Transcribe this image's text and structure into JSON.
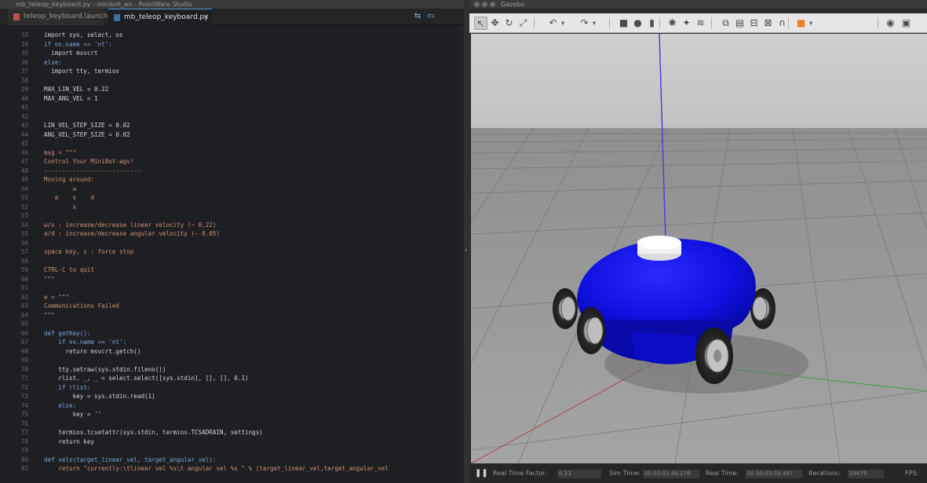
{
  "editor": {
    "window_title": "mb_teleop_keyboard.py - minibot_ws - RoboWare Studio",
    "tabs": [
      {
        "label": "teleop_keyboard.launch",
        "close": "×"
      },
      {
        "label": "mb_teleop_keyboard.py",
        "close": "×"
      }
    ],
    "tab_icons": {
      "split": "⇆",
      "more": "▭"
    },
    "lines": [
      {
        "num": "33",
        "text": "import sys, select, os",
        "style": "c-plain"
      },
      {
        "num": "34",
        "text": "if os.name == 'nt':",
        "style": "c-kw"
      },
      {
        "num": "35",
        "text": "  import msvcrt",
        "style": "c-plain"
      },
      {
        "num": "36",
        "text": "else:",
        "style": "c-kw"
      },
      {
        "num": "37",
        "text": "  import tty, termios",
        "style": "c-plain"
      },
      {
        "num": "38",
        "text": "",
        "style": "c-plain"
      },
      {
        "num": "39",
        "text": "MAX_LIN_VEL = 0.22",
        "style": "c-plain"
      },
      {
        "num": "40",
        "text": "MAX_ANG_VEL = 1",
        "style": "c-plain"
      },
      {
        "num": "41",
        "text": "",
        "style": "c-plain"
      },
      {
        "num": "42",
        "text": "",
        "style": "c-plain"
      },
      {
        "num": "43",
        "text": "LIN_VEL_STEP_SIZE = 0.02",
        "style": "c-plain"
      },
      {
        "num": "44",
        "text": "ANG_VEL_STEP_SIZE = 0.02",
        "style": "c-plain"
      },
      {
        "num": "45",
        "text": "",
        "style": "c-plain"
      },
      {
        "num": "46",
        "text": "msg = \"\"\"",
        "style": "c-str"
      },
      {
        "num": "47",
        "text": "Control Your MiniBot-agv!",
        "style": "c-str"
      },
      {
        "num": "48",
        "text": "---------------------------",
        "style": "c-str"
      },
      {
        "num": "49",
        "text": "Moving around:",
        "style": "c-str"
      },
      {
        "num": "50",
        "text": "        w",
        "style": "c-str"
      },
      {
        "num": "51",
        "text": "   a    s    d",
        "style": "c-str"
      },
      {
        "num": "52",
        "text": "        x",
        "style": "c-str"
      },
      {
        "num": "53",
        "text": "",
        "style": "c-str"
      },
      {
        "num": "54",
        "text": "w/x : increase/decrease linear velocity (~ 0.22)",
        "style": "c-str"
      },
      {
        "num": "55",
        "text": "a/d : increase/decrease angular velocity (~ 0.05)",
        "style": "c-str"
      },
      {
        "num": "56",
        "text": "",
        "style": "c-str"
      },
      {
        "num": "57",
        "text": "space key, s : force stop",
        "style": "c-str"
      },
      {
        "num": "58",
        "text": "",
        "style": "c-str"
      },
      {
        "num": "59",
        "text": "CTRL-C to quit",
        "style": "c-str"
      },
      {
        "num": "60",
        "text": "\"\"\"",
        "style": "c-str"
      },
      {
        "num": "61",
        "text": "",
        "style": "c-plain"
      },
      {
        "num": "62",
        "text": "e = \"\"\"",
        "style": "c-str"
      },
      {
        "num": "63",
        "text": "Communications Failed",
        "style": "c-str"
      },
      {
        "num": "64",
        "text": "\"\"\"",
        "style": "c-str"
      },
      {
        "num": "65",
        "text": "",
        "style": "c-plain"
      },
      {
        "num": "66",
        "text": "def getKey():",
        "style": "c-kw"
      },
      {
        "num": "67",
        "text": "    if os.name == 'nt':",
        "style": "c-kw"
      },
      {
        "num": "68",
        "text": "      return msvcrt.getch()",
        "style": "c-plain"
      },
      {
        "num": "69",
        "text": "",
        "style": "c-plain"
      },
      {
        "num": "70",
        "text": "    tty.setraw(sys.stdin.fileno())",
        "style": "c-plain"
      },
      {
        "num": "71",
        "text": "    rlist, _, _ = select.select([sys.stdin], [], [], 0.1)",
        "style": "c-plain"
      },
      {
        "num": "72",
        "text": "    if rlist:",
        "style": "c-kw"
      },
      {
        "num": "73",
        "text": "        key = sys.stdin.read(1)",
        "style": "c-plain"
      },
      {
        "num": "74",
        "text": "    else:",
        "style": "c-kw"
      },
      {
        "num": "75",
        "text": "        key = ''",
        "style": "c-plain"
      },
      {
        "num": "76",
        "text": "",
        "style": "c-plain"
      },
      {
        "num": "77",
        "text": "    termios.tcsetattr(sys.stdin, termios.TCSADRAIN, settings)",
        "style": "c-plain"
      },
      {
        "num": "78",
        "text": "    return key",
        "style": "c-plain"
      },
      {
        "num": "79",
        "text": "",
        "style": "c-plain"
      },
      {
        "num": "80",
        "text": "def vels(target_linear_vel, target_angular_vel):",
        "style": "c-kw"
      },
      {
        "num": "81",
        "text": "    return \"currently:\\tlinear vel %s\\t angular vel %s \" % (target_linear_vel,target_angular_vel",
        "style": "c-str"
      }
    ]
  },
  "gazebo": {
    "window_title": "Gazebo",
    "toolbar": [
      {
        "name": "select-mode-tool",
        "glyph": "↖",
        "active": true
      },
      {
        "name": "translate-mode-tool",
        "glyph": "✥",
        "active": false
      },
      {
        "name": "rotate-mode-tool",
        "glyph": "↻",
        "active": false
      },
      {
        "name": "scale-mode-tool",
        "glyph": "⤢",
        "active": false
      },
      {
        "name": "undo-tool",
        "glyph": "↶",
        "active": false
      },
      {
        "name": "undo-dropdown-tool",
        "glyph": "▾",
        "active": false
      },
      {
        "name": "redo-tool",
        "glyph": "↷",
        "active": false
      },
      {
        "name": "redo-dropdown-tool",
        "glyph": "▾",
        "active": false
      },
      {
        "name": "box-shape-tool",
        "glyph": "■",
        "active": false
      },
      {
        "name": "sphere-shape-tool",
        "glyph": "●",
        "active": false
      },
      {
        "name": "cylinder-shape-tool",
        "glyph": "▮",
        "active": false
      },
      {
        "name": "point-light-tool",
        "glyph": "✺",
        "active": false
      },
      {
        "name": "spot-light-tool",
        "glyph": "✦",
        "active": false
      },
      {
        "name": "directional-light-tool",
        "glyph": "≋",
        "active": false
      },
      {
        "name": "copy-tool",
        "glyph": "⧉",
        "active": false
      },
      {
        "name": "paste-tool",
        "glyph": "▤",
        "active": false
      },
      {
        "name": "align-tool",
        "glyph": "⊟",
        "active": false
      },
      {
        "name": "snap-tool",
        "glyph": "⊠",
        "active": false
      },
      {
        "name": "joint-tool",
        "glyph": "∩",
        "active": false
      },
      {
        "name": "change-view-tool",
        "glyph": "■",
        "active": false
      },
      {
        "name": "change-view-dropdown-tool",
        "glyph": "▾",
        "active": false
      },
      {
        "name": "screenshot-tool",
        "glyph": "◉",
        "active": false
      },
      {
        "name": "record-tool",
        "glyph": "▣",
        "active": false
      }
    ],
    "status": {
      "pause_glyph": "❚❚",
      "real_time_factor_label": "Real Time Factor:",
      "real_time_factor_value": "0.23",
      "sim_time_label": "Sim Time:",
      "sim_time_value": "00 00:01:46.179",
      "real_time_label": "Real Time:",
      "real_time_value": "00 00:03:59.497",
      "iterations_label": "Iterations:",
      "iterations_value": "59479",
      "fps_label": "FPS:"
    }
  },
  "colors": {
    "robot_body": "#1010e6",
    "lidar": "#f0f0f0",
    "sky": "#c8c8c8",
    "ground": "#9a9a9a",
    "axis_x": "#b04040",
    "axis_y": "#40a040",
    "axis_z": "#4040d0"
  }
}
